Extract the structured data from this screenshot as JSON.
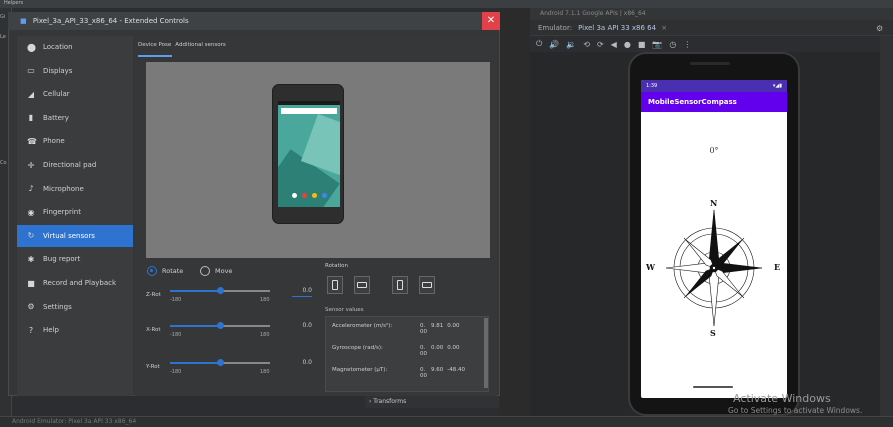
{
  "ide": {
    "helpers_label": "Helpers",
    "left_letters": [
      "Gi",
      "Le",
      "Co"
    ],
    "bottom_status": "Android Emulator: Pixel 3a API 33 x86_64",
    "top_small": "Android 7.1.1 Google APIs | x86_64"
  },
  "emulator": {
    "tab_prefix": "Emulator:",
    "tab_name": "Pixel 3a API 33 x86 64",
    "tab_close": "×",
    "toolbar_icons": [
      "power-icon",
      "volume-up-icon",
      "volume-down-icon",
      "rotate-left-icon",
      "rotate-right-icon",
      "back-icon",
      "home-icon",
      "overview-icon",
      "camera-icon",
      "snapshot-icon",
      "more-icon"
    ],
    "toolbar_glyphs": [
      "⏻",
      "🔊",
      "🔉",
      "⟲",
      "⟳",
      "◀",
      "●",
      "■",
      "📷",
      "◷",
      "⋮"
    ],
    "settings_glyph": "⚙"
  },
  "app": {
    "status_time": "1:39",
    "status_icons": "▾◢▮",
    "title": "MobileSensorCompass",
    "heading": "0°",
    "compass": {
      "n": "N",
      "s": "S",
      "e": "E",
      "w": "W"
    }
  },
  "watermark": {
    "title": "Activate Windows",
    "subtitle": "Go to Settings to activate Windows."
  },
  "dialog": {
    "title": "Pixel_3a_API_33_x86_64 - Extended Controls",
    "close": "✕",
    "menu": [
      {
        "label": "Location",
        "glyph": "⬤"
      },
      {
        "label": "Displays",
        "glyph": "▭"
      },
      {
        "label": "Cellular",
        "glyph": "◢"
      },
      {
        "label": "Battery",
        "glyph": "▮"
      },
      {
        "label": "Phone",
        "glyph": "☎"
      },
      {
        "label": "Directional pad",
        "glyph": "✛"
      },
      {
        "label": "Microphone",
        "glyph": "♪"
      },
      {
        "label": "Fingerprint",
        "glyph": "◉"
      },
      {
        "label": "Virtual sensors",
        "glyph": "↻",
        "active": true
      },
      {
        "label": "Bug report",
        "glyph": "✱"
      },
      {
        "label": "Record and Playback",
        "glyph": "■"
      },
      {
        "label": "Settings",
        "glyph": "⚙"
      },
      {
        "label": "Help",
        "glyph": "?"
      }
    ],
    "tabs": [
      "Device Pose",
      "Additional sensors"
    ],
    "mode": {
      "rotate": "Rotate",
      "move": "Move"
    },
    "sliders": [
      {
        "label": "Z-Rot",
        "min": "-180",
        "max": "180",
        "value": "0.0",
        "level": 0.5
      },
      {
        "label": "X-Rot",
        "min": "-180",
        "max": "180",
        "value": "0.0",
        "level": 0.5
      },
      {
        "label": "Y-Rot",
        "min": "-180",
        "max": "180",
        "value": "0.0",
        "level": 0.5
      }
    ],
    "rotation_label": "Rotation",
    "sensor_values_label": "Sensor values",
    "sensors": [
      {
        "name": "Accelerometer (m/s²):",
        "v1": "0.",
        "v1b": "00",
        "v2": "9.81",
        "v3": "0.00"
      },
      {
        "name": "Gyroscope (rad/s):",
        "v1": "0.",
        "v1b": "00",
        "v2": "0.00",
        "v3": "0.00"
      },
      {
        "name": "Magnetometer (μT):",
        "v1": "0.",
        "v1b": "00",
        "v2": "9.60",
        "v3": "-48.40"
      }
    ],
    "transforms": "› Transforms"
  }
}
